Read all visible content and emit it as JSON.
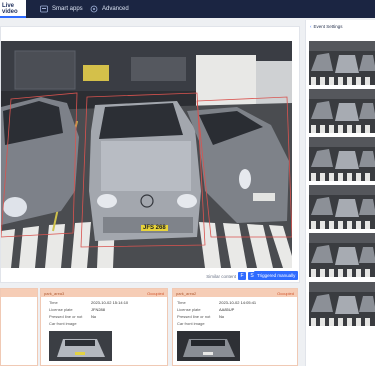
{
  "nav": {
    "tabs": [
      {
        "label": "Live video",
        "icon": "video-icon"
      },
      {
        "label": "Smart apps",
        "icon": "apps-icon"
      },
      {
        "label": "Advanced",
        "icon": "gear-icon"
      }
    ]
  },
  "video": {
    "plate_center": "JFS 268",
    "similar_label": "Similar content",
    "similar_buttons": [
      "F",
      "S"
    ],
    "trigger_label": "Triggered manually"
  },
  "events": [
    {
      "zone": "park_area3",
      "status": "Occupied",
      "time_label": "Time",
      "time": "2023-10-02 15:14:10",
      "plate_label": "License plate",
      "plate": "JFN288",
      "line_label": "Pressed line or not",
      "line": "No",
      "image_label": "Car front image"
    },
    {
      "zone": "park_area2",
      "status": "Occupied",
      "time_label": "Time",
      "time": "2023-10-02 14:05:41",
      "plate_label": "License plate",
      "plate": "AA85UP",
      "line_label": "Pressed line or not",
      "line": "No",
      "image_label": "Car front image"
    }
  ],
  "sidebar": {
    "title": "Event Settings"
  },
  "colors": {
    "nav_bg": "#1b2542",
    "accent": "#2f6bff",
    "occupied_header": "#f6cdb6",
    "occupied_text": "#d0532a"
  }
}
